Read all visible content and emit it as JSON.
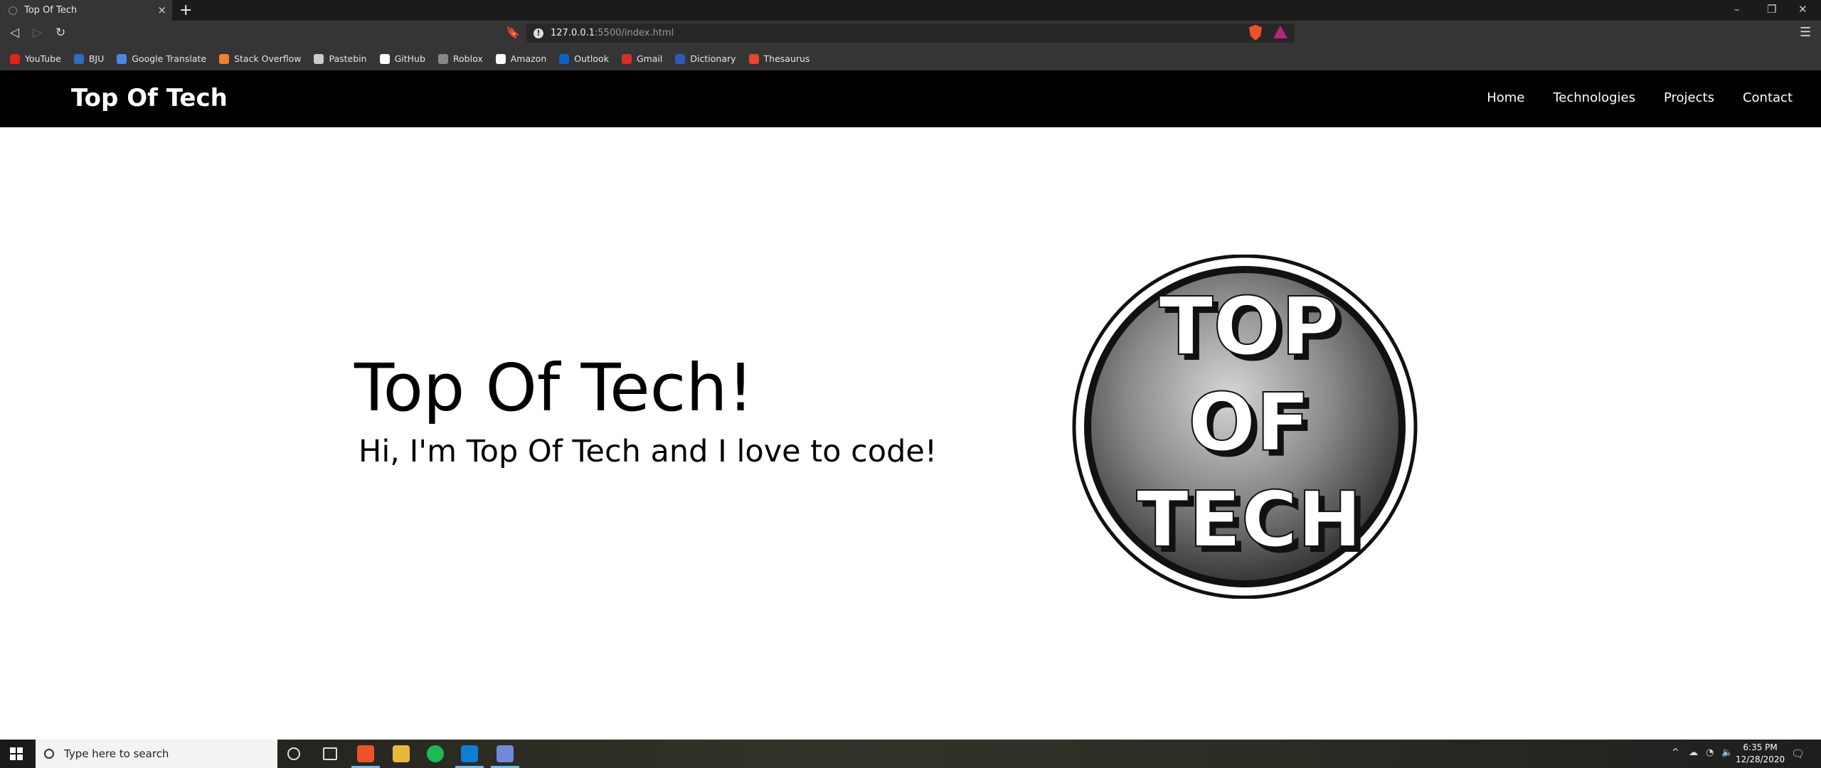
{
  "browser": {
    "tab_title": "Top Of Tech",
    "tab_close": "×",
    "new_tab": "+",
    "url_host": "127.0.0.1",
    "url_path": ":5500/index.html",
    "window_controls": [
      "–",
      "❐",
      "✕"
    ],
    "bookmarks": [
      {
        "label": "YouTube",
        "color": "#e62117"
      },
      {
        "label": "BJU",
        "color": "#2d6cc0"
      },
      {
        "label": "Google Translate",
        "color": "#4a86e8"
      },
      {
        "label": "Stack Overflow",
        "color": "#f48024"
      },
      {
        "label": "Pastebin",
        "color": "#cccccc"
      },
      {
        "label": "GitHub",
        "color": "#ffffff"
      },
      {
        "label": "Roblox",
        "color": "#888888"
      },
      {
        "label": "Amazon",
        "color": "#ffffff"
      },
      {
        "label": "Outlook",
        "color": "#0a64c8"
      },
      {
        "label": "Gmail",
        "color": "#d93025"
      },
      {
        "label": "Dictionary",
        "color": "#2b5bb8"
      },
      {
        "label": "Thesaurus",
        "color": "#e6472c"
      }
    ]
  },
  "site": {
    "logo": "Top Of Tech",
    "nav": [
      "Home",
      "Technologies",
      "Projects",
      "Contact"
    ]
  },
  "hero": {
    "title": "Top Of Tech!",
    "subtitle": "Hi, I'm Top Of Tech and I love to code!",
    "logo_lines": [
      "TOP",
      "OF",
      "TECH"
    ]
  },
  "taskbar": {
    "search_placeholder": "Type here to search",
    "time": "6:35 PM",
    "date": "12/28/2020"
  },
  "colors": {
    "header_bg": "#000000",
    "page_bg": "#ffffff",
    "browser_bg": "#353535"
  }
}
